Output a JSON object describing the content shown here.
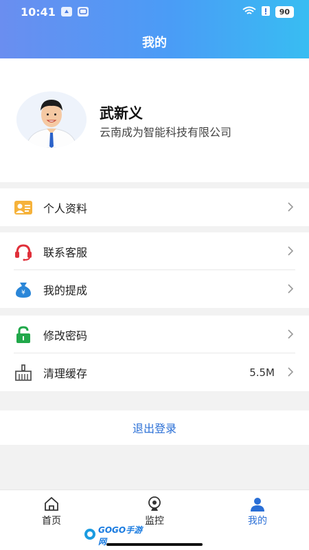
{
  "status_bar": {
    "time": "10:41",
    "battery": "90"
  },
  "header": {
    "title": "我的"
  },
  "profile": {
    "name": "武新义",
    "company": "云南成为智能科技有限公司"
  },
  "menu": {
    "group1": [
      {
        "label": "个人资料",
        "icon": "profile-card-icon"
      }
    ],
    "group2": [
      {
        "label": "联系客服",
        "icon": "headset-icon"
      },
      {
        "label": "我的提成",
        "icon": "money-bag-icon"
      }
    ],
    "group3": [
      {
        "label": "修改密码",
        "icon": "lock-icon"
      },
      {
        "label": "清理缓存",
        "icon": "broom-icon",
        "value": "5.5M"
      }
    ]
  },
  "logout": {
    "label": "退出登录"
  },
  "tabs": [
    {
      "label": "首页",
      "icon": "home-icon",
      "active": false
    },
    {
      "label": "监控",
      "icon": "camera-icon",
      "active": false
    },
    {
      "label": "我的",
      "icon": "user-icon",
      "active": true
    }
  ],
  "watermark": {
    "text": "GOGO手游网"
  },
  "colors": {
    "accent": "#2a6fd6",
    "header_start": "#6a8ef0",
    "header_end": "#38bdf2"
  }
}
